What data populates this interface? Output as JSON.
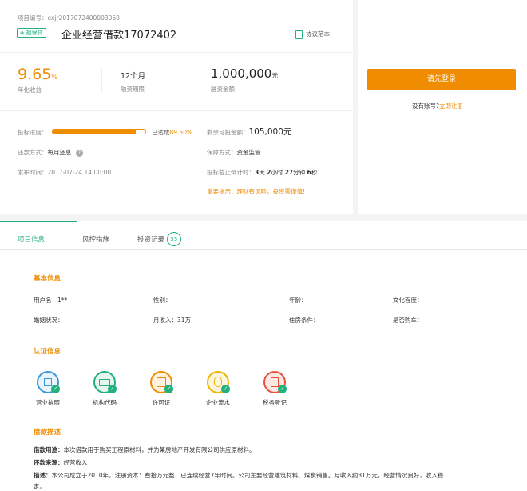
{
  "project": {
    "number_label": "项目编号：exjr2017072400003060",
    "tag": "担保贷",
    "title": "企业经营借款17072402",
    "agreement": "协议范本"
  },
  "stats": {
    "rate_value": "9.65",
    "rate_unit": "%",
    "rate_label": "年化收益",
    "term_value": "12个月",
    "term_label": "融资期限",
    "amount_value": "1,000,000",
    "amount_unit": "元",
    "amount_label": "融资金额"
  },
  "progress": {
    "label": "投标进度：",
    "fraction": 0.895,
    "status_prefix": "已达成",
    "status_value": "89.50%",
    "remain_label": "剩余可投金额：",
    "remain_value": "105,000元"
  },
  "details": {
    "repay_label": "还款方式：",
    "repay_value": "每月还息",
    "guarantee_label": "保障方式：",
    "guarantee_value": "资金监管",
    "publish_label": "发布时间：",
    "publish_value": "2017-07-24 14:00:00",
    "countdown_label": "投标截止倒计时：",
    "countdown_d": "3",
    "countdown_d_unit": "天",
    "countdown_h": "2",
    "countdown_h_unit": "小时",
    "countdown_m": "27",
    "countdown_m_unit": "分钟",
    "countdown_s": "6",
    "countdown_s_unit": "秒",
    "notice": "重要提示：理财有风险，投资需谨慎!"
  },
  "login": {
    "button": "请先登录",
    "no_account": "没有账号?",
    "register": "立即注册"
  },
  "tabs": [
    {
      "label": "项目信息"
    },
    {
      "label": "风控措施"
    },
    {
      "label": "投资记录",
      "badge": "33"
    }
  ],
  "basic": {
    "title": "基本信息",
    "user_label": "用户名：",
    "user_value": "1**",
    "gender_label": "性别：",
    "age_label": "年龄：",
    "edu_label": "文化程度：",
    "marital_label": "婚姻状况：",
    "income_label": "月收入：",
    "income_value": "31万",
    "housing_label": "住房条件：",
    "car_label": "是否购车："
  },
  "certs": {
    "title": "认证信息",
    "items": [
      {
        "label": "营业执照",
        "icon": "business-license-icon",
        "color": "#3a9ad9"
      },
      {
        "label": "机构代码",
        "icon": "org-code-icon",
        "color": "#22b07d"
      },
      {
        "label": "许可证",
        "icon": "permit-icon",
        "color": "#f08c00"
      },
      {
        "label": "企业流水",
        "icon": "bank-flow-icon",
        "color": "#f0b400"
      },
      {
        "label": "税务登记",
        "icon": "tax-registration-icon",
        "color": "#e8533c"
      }
    ]
  },
  "loan": {
    "title": "借款描述",
    "purpose_label": "借款用途：",
    "purpose_value": "本次借款用于购买工程原材料，并为某房地产开发有限公司供应原材料。",
    "source_label": "还款来源：",
    "source_value": "经营收入",
    "desc_label": "描述：",
    "desc_value": "本公司成立于2010年，注册资本：叁拾万元整，已连续经营7年时间。公司主要经营建筑材料、煤炭销售。月收入约31万元，经营情况良好，收入稳",
    "desc_value_2": "定。"
  }
}
